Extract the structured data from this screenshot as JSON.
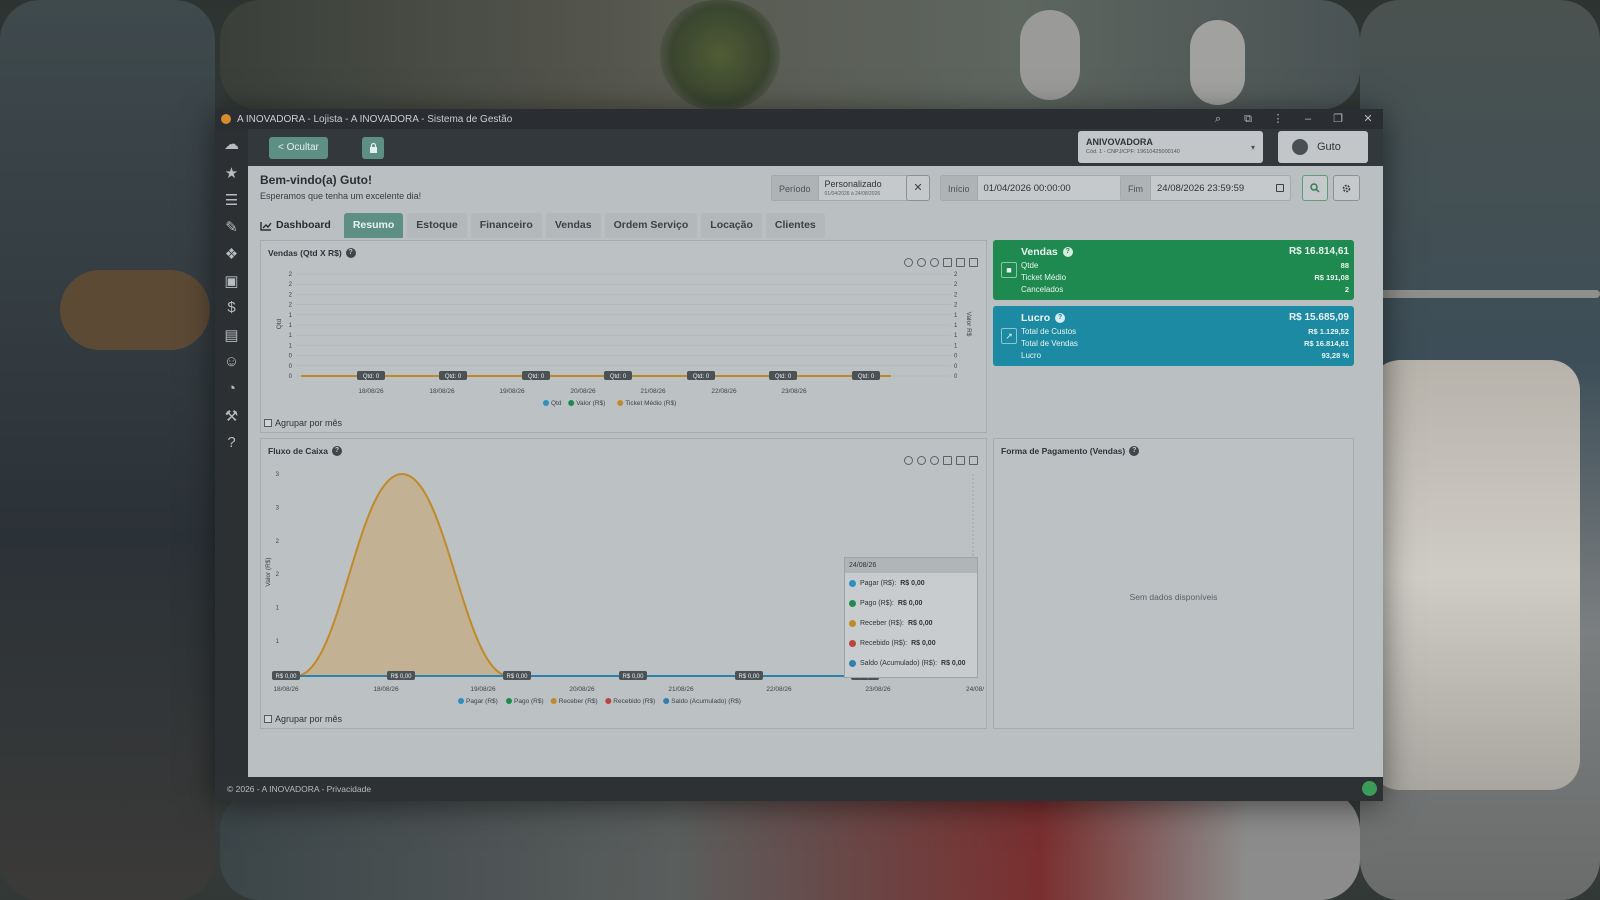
{
  "window": {
    "title": "A INOVADORA - Lojista - A INOVADORA - Sistema de Gestão"
  },
  "topbar": {
    "hide_label": "< Ocultar",
    "company_name": "ANIVOVADORA",
    "company_sub": "Cód. 1 - CNPJ/CPF: 19610425000140",
    "user_name": "Guto"
  },
  "welcome": {
    "title": "Bem-vindo(a) Guto!",
    "subtitle": "Esperamos que tenha um excelente dia!"
  },
  "filters": {
    "periodo_label": "Período",
    "periodo_value": "Personalizado",
    "periodo_range": "01/04/2026 à 24/08/2026",
    "inicio_label": "Início",
    "inicio_value": "01/04/2026 00:00:00",
    "fim_label": "Fim",
    "fim_value": "24/08/2026 23:59:59"
  },
  "tabs": [
    {
      "label": "Dashboard"
    },
    {
      "label": "Resumo"
    },
    {
      "label": "Estoque"
    },
    {
      "label": "Financeiro"
    },
    {
      "label": "Vendas"
    },
    {
      "label": "Ordem Serviço"
    },
    {
      "label": "Locação"
    },
    {
      "label": "Clientes"
    }
  ],
  "cards": {
    "vendas": {
      "title": "Vendas",
      "value": "R$ 16.814,61",
      "rows": [
        {
          "label": "Qtde",
          "value": "88"
        },
        {
          "label": "Ticket Médio",
          "value": "R$ 191,08"
        },
        {
          "label": "Cancelados",
          "value": "2"
        }
      ],
      "color": "#1f8a4f"
    },
    "lucro": {
      "title": "Lucro",
      "value": "R$ 15.685,09",
      "rows": [
        {
          "label": "Total de Custos",
          "value": "R$ 1.129,52"
        },
        {
          "label": "Total de Vendas",
          "value": "R$ 16.814,61"
        },
        {
          "label": "Lucro",
          "value": "93,28 %"
        }
      ],
      "color": "#1d8aa3"
    }
  },
  "agrupar_label": "Agrupar por mês",
  "forma_pagamento": {
    "title": "Forma de Pagamento (Vendas)",
    "empty": "Sem dados disponíveis"
  },
  "tooltip": {
    "date": "24/08/26",
    "rows": [
      {
        "label": "Pagar (R$):",
        "value": "R$ 0,00",
        "color": "#2f8fbd"
      },
      {
        "label": "Pago (R$):",
        "value": "R$ 0,00",
        "color": "#1f8a4f"
      },
      {
        "label": "Receber (R$):",
        "value": "R$ 0,00",
        "color": "#c08a2a"
      },
      {
        "label": "Recebido (R$):",
        "value": "R$ 0,00",
        "color": "#b8443a"
      },
      {
        "label": "Saldo (Acumulado) (R$):",
        "value": "R$ 0,00",
        "color": "#2f7fb0"
      }
    ]
  },
  "footer": {
    "text": "© 2026 - A INOVADORA - Privacidade"
  },
  "chart_data": [
    {
      "type": "line",
      "title": "Vendas (Qtd X R$)",
      "ylabel": "Qtd",
      "y2label": "Valor R$",
      "x": [
        "18/08/26",
        "18/08/26",
        "19/08/26",
        "20/08/26",
        "21/08/26",
        "22/08/26",
        "23/08/26"
      ],
      "y_ticks": [
        "2",
        "2",
        "2",
        "2",
        "1",
        "1",
        "1",
        "1",
        "0",
        "0",
        "0"
      ],
      "series": [
        {
          "name": "Qtd",
          "values": [
            0,
            0,
            0,
            0,
            0,
            0,
            0
          ],
          "color": "#2f8fbd"
        },
        {
          "name": "Valor (R$)",
          "values": [
            0,
            0,
            0,
            0,
            0,
            0,
            0
          ],
          "color": "#1f8a4f"
        },
        {
          "name": "Ticket Médio (R$)",
          "values": [
            0,
            0,
            0,
            0,
            0,
            0,
            0
          ],
          "color": "#c08a2a"
        }
      ],
      "data_labels": [
        "Qtd: 0",
        "Qtd: 0",
        "Qtd: 0",
        "Qtd: 0",
        "Qtd: 0",
        "Qtd: 0",
        "Qtd: 0"
      ],
      "legend": "bottom"
    },
    {
      "type": "area",
      "title": "Fluxo de Caixa",
      "ylabel": "Valor (R$)",
      "x": [
        "18/08/26",
        "18/08/26",
        "19/08/26",
        "20/08/26",
        "21/08/26",
        "22/08/26",
        "23/08/26",
        "24/08/"
      ],
      "y_ticks": [
        "3",
        "3",
        "2",
        "2",
        "1",
        "1"
      ],
      "ylim": [
        0,
        3
      ],
      "series": [
        {
          "name": "Pagar (R$)",
          "values": [
            0,
            0,
            0,
            0,
            0,
            0,
            0,
            0
          ],
          "color": "#2f8fbd"
        },
        {
          "name": "Pago (R$)",
          "values": [
            0,
            0,
            0,
            0,
            0,
            0,
            0,
            0
          ],
          "color": "#1f8a4f"
        },
        {
          "name": "Receber (R$)",
          "values": [
            0,
            3,
            0,
            0,
            0,
            0,
            0,
            0
          ],
          "color": "#c08a2a"
        },
        {
          "name": "Recebido (R$)",
          "values": [
            0,
            0,
            0,
            0,
            0,
            0,
            0,
            0
          ],
          "color": "#b8443a"
        },
        {
          "name": "Saldo (Acumulado) (R$)",
          "values": [
            0,
            0,
            0,
            0,
            0,
            0,
            0,
            0
          ],
          "color": "#2f7fb0"
        }
      ],
      "data_labels": [
        "R$ 0,00",
        "R$ 0,00",
        "R$ 0,00",
        "R$ 0,00",
        "R$ 0,00",
        "R$ 0,00"
      ],
      "legend": "bottom"
    }
  ]
}
